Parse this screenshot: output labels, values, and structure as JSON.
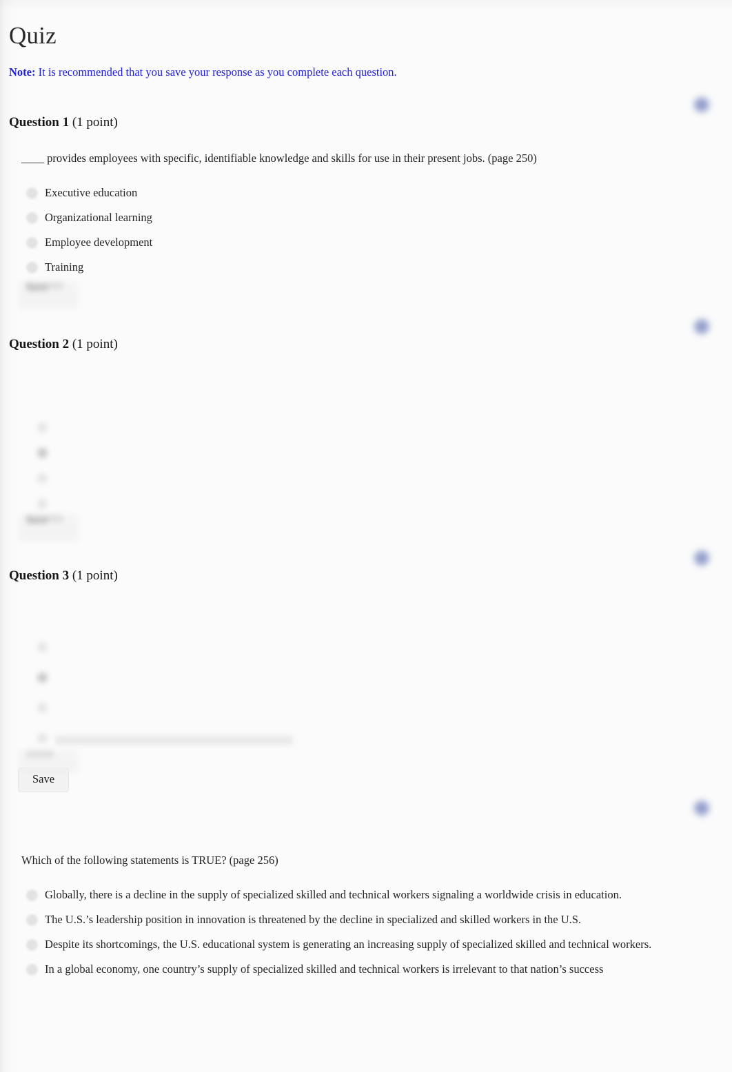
{
  "page": {
    "title": "Quiz",
    "note_label": "Note:",
    "note_text": " It is recommended that you save your response as you complete each question."
  },
  "colors": {
    "note_blue": "#1f1fd8",
    "text": "#242424",
    "heading": "#171717",
    "background": "#fbfbfb",
    "icon_blue": "#7d8ac4",
    "button_face": "#f2f2f2"
  },
  "icons": {
    "question_flag": "flag-icon",
    "radio": "radio-button-icon"
  },
  "buttons": {
    "save_label": "Save"
  },
  "questions": [
    {
      "id": "q1",
      "label": "Question 1",
      "points": "(1 point)",
      "prompt": "____ provides employees with specific, identifiable knowledge and skills for use in their present jobs.   (page 250)",
      "visible": true,
      "options": [
        "Executive education",
        "Organizational learning",
        "Employee development",
        "Training"
      ],
      "save_label": "Save",
      "save_visible": false
    },
    {
      "id": "q2",
      "label": "Question 2",
      "points": "(1 point)",
      "prompt": "",
      "visible": false,
      "options": [
        "",
        "",
        "",
        ""
      ],
      "save_label": "Save",
      "save_visible": false
    },
    {
      "id": "q3",
      "label": "Question 3",
      "points": "(1 point)",
      "prompt": "",
      "visible": false,
      "options": [
        "",
        "",
        "",
        ""
      ],
      "save_label": "Save",
      "save_visible": true
    },
    {
      "id": "q4",
      "label": "",
      "points": "",
      "prompt": "Which of the following statements is TRUE?   (page 256)",
      "visible": true,
      "options": [
        "Globally, there is a decline in the supply of specialized skilled and technical workers signaling a worldwide crisis in education.",
        "The U.S.’s leadership position in innovation is threatened by the decline in specialized and skilled workers in the U.S.",
        "Despite its shortcomings, the U.S. educational system is generating an increasing supply of specialized skilled and technical workers.",
        "In a global economy, one country’s supply of specialized skilled and technical workers is irrelevant to that nation’s success"
      ],
      "save_label": "Save",
      "save_visible": false
    }
  ]
}
